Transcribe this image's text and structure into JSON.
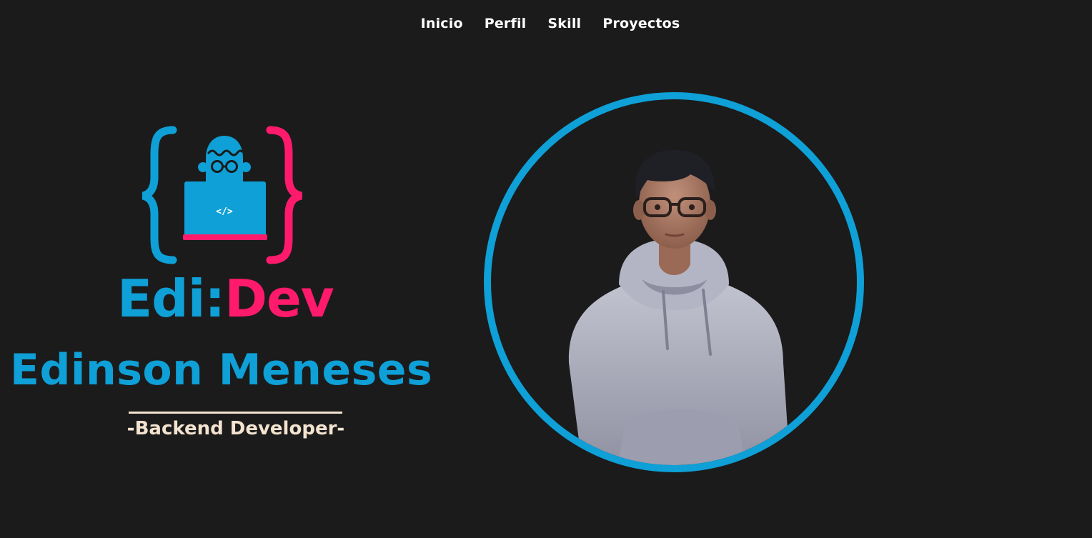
{
  "nav": {
    "items": [
      {
        "label": "Inicio"
      },
      {
        "label": "Perfil"
      },
      {
        "label": "Skill"
      },
      {
        "label": "Proyectos"
      }
    ]
  },
  "logo": {
    "code_symbol": "</>",
    "brand_left": "Edi:",
    "brand_right": "Dev"
  },
  "hero": {
    "name": "Edinson Meneses",
    "role": "-Backend Developer-"
  },
  "colors": {
    "background": "#1b1b1c",
    "accent_blue": "#0ea0d6",
    "accent_pink": "#ff1a6c",
    "cream": "#f4e3cf",
    "nav_text": "#ffffff"
  },
  "icons": {
    "logo": "robot-laptop-braces-icon",
    "avatar": "developer-avatar-3d"
  }
}
